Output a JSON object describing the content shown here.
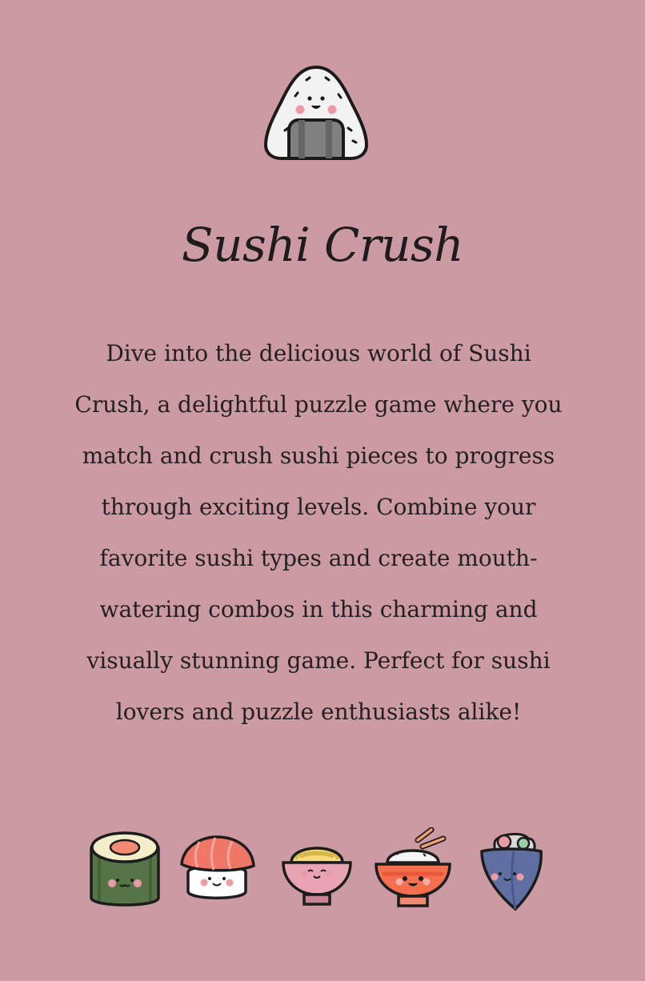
{
  "app": {
    "title": "Sushi Crush",
    "logo_icon": "onigiri-icon"
  },
  "content": {
    "description": "Dive into the delicious world of Sushi Crush, a delightful puzzle game where you match and crush sushi pieces to progress through exciting levels. Combine your favorite sushi types and create mouth-watering combos in this charming and visually stunning game. Perfect for sushi lovers and puzzle enthusiasts alike!"
  },
  "footer": {
    "icons": [
      "maki-roll-icon",
      "salmon-nigiri-icon",
      "noodle-bowl-icon",
      "rice-bowl-icon",
      "temaki-icon"
    ]
  },
  "colors": {
    "background": "#cb9aa3",
    "text": "#241f22"
  }
}
